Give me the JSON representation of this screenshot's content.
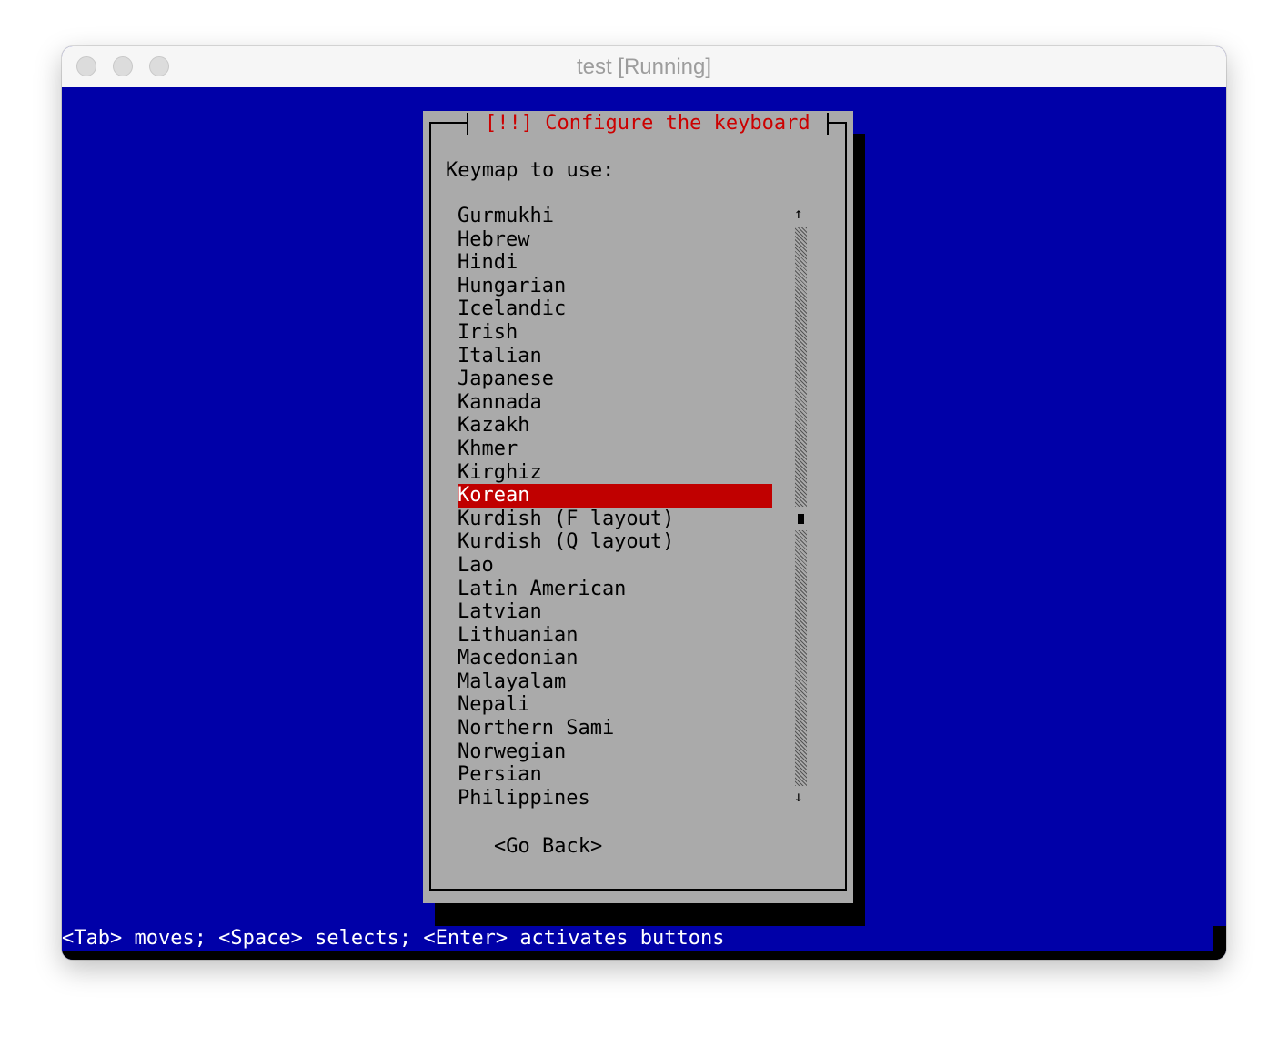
{
  "window": {
    "title": "test [Running]"
  },
  "dialog": {
    "title": "[!!] Configure the keyboard",
    "prompt": "Keymap to use:",
    "items": [
      "Gurmukhi",
      "Hebrew",
      "Hindi",
      "Hungarian",
      "Icelandic",
      "Irish",
      "Italian",
      "Japanese",
      "Kannada",
      "Kazakh",
      "Khmer",
      "Kirghiz",
      "Korean",
      "Kurdish (F layout)",
      "Kurdish (Q layout)",
      "Lao",
      "Latin American",
      "Latvian",
      "Lithuanian",
      "Macedonian",
      "Malayalam",
      "Nepali",
      "Northern Sami",
      "Norwegian",
      "Persian",
      "Philippines"
    ],
    "selected_index": 12,
    "scroll_up": "↑",
    "scroll_down": "↓",
    "go_back": "<Go Back>"
  },
  "statusbar": {
    "text": "<Tab> moves; <Space> selects; <Enter> activates buttons"
  },
  "colors": {
    "screen_bg": "#0000a8",
    "dialog_bg": "#aaaaaa",
    "title_red": "#cc0000",
    "selection": "#c00000"
  }
}
